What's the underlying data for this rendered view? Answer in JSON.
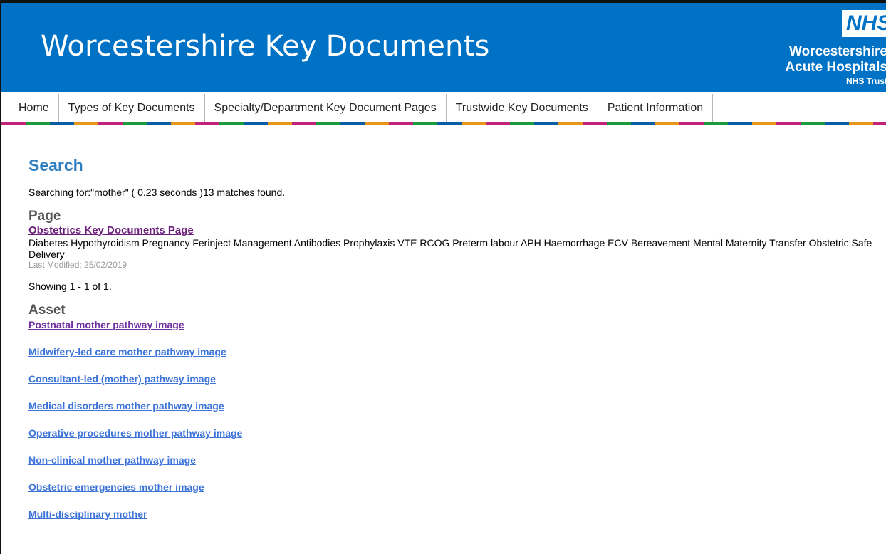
{
  "header": {
    "title": "Worcestershire Key Documents",
    "logo": {
      "mark": "NHS",
      "line1": "Worcestershire",
      "line2": "Acute Hospitals",
      "line3": "NHS Trust"
    }
  },
  "nav": {
    "items": [
      {
        "label": "Home"
      },
      {
        "label": "Types of Key Documents"
      },
      {
        "label": "Specialty/Department Key Document Pages"
      },
      {
        "label": "Trustwide Key Documents"
      },
      {
        "label": "Patient Information"
      }
    ]
  },
  "search": {
    "title": "Search",
    "summary": "Searching for:\"mother\" ( 0.23 seconds )13  matches found."
  },
  "page_section": {
    "heading": "Page",
    "result": {
      "title": "Obstetrics Key Documents Page",
      "snippet": "Diabetes Hypothyroidism Pregnancy Ferinject Management Antibodies Prophylaxis VTE RCOG Preterm labour APH Haemorrhage ECV Bereavement Mental Maternity Transfer Obstetric Safe Delivery",
      "modified": "Last Modified: 25/02/2019"
    },
    "showing": "Showing 1 - 1 of 1."
  },
  "asset_section": {
    "heading": "Asset",
    "items": [
      {
        "label": "Postnatal mother pathway image"
      },
      {
        "label": "Midwifery-led care mother pathway image"
      },
      {
        "label": "Consultant-led (mother) pathway image"
      },
      {
        "label": "Medical disorders mother pathway image"
      },
      {
        "label": "Operative procedures mother pathway image"
      },
      {
        "label": "Non-clinical mother pathway image"
      },
      {
        "label": "Obstetric emergencies mother image"
      },
      {
        "label": "Multi-disciplinary mother"
      }
    ]
  },
  "colors": {
    "banner": "#0072c6",
    "heading_blue": "#2d7fc1",
    "link_blue": "#3b73d9",
    "visited_purple": "#7030a0",
    "stripe": [
      "#c1237a",
      "#1a9b3c",
      "#0b5ba7",
      "#e8961a"
    ]
  }
}
